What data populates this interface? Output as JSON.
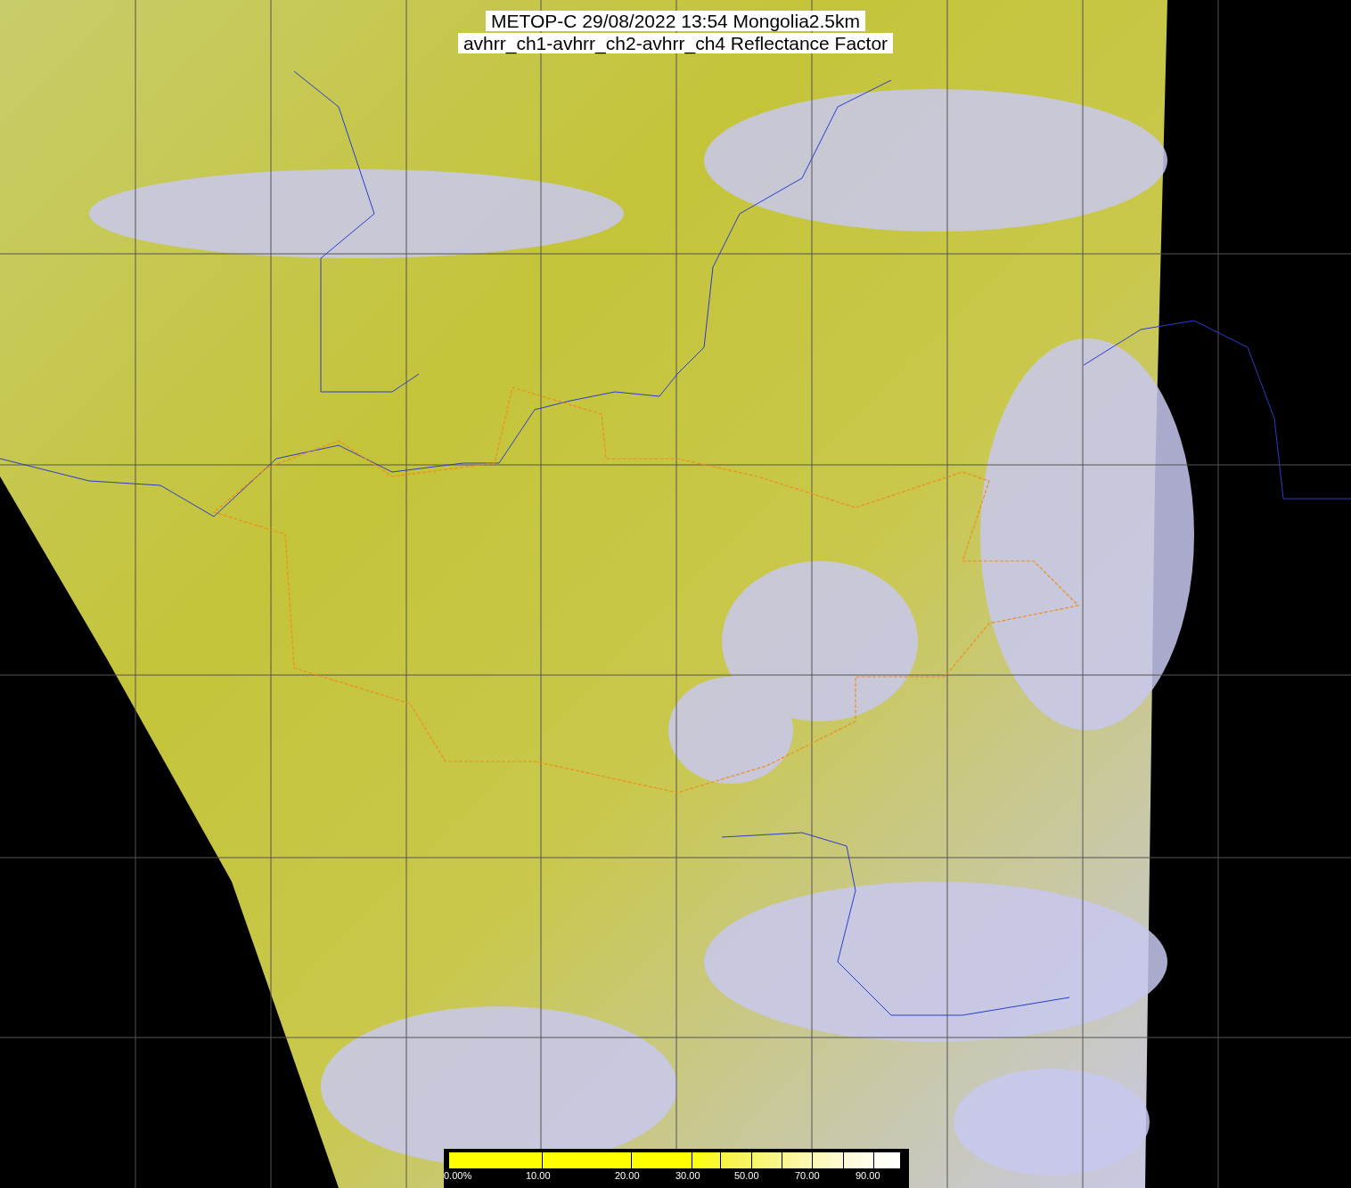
{
  "title": {
    "lines": [
      "METOP-C 29/08/2022 13:54 Mongolia2.5km",
      "avhrr_ch1-avhrr_ch2-avhrr_ch4 Reflectance Factor"
    ]
  },
  "colorbar": {
    "ticks": [
      "0.00%",
      "10.00",
      "20.00",
      "30.00",
      "50.00",
      "70.00",
      "90.00"
    ]
  }
}
